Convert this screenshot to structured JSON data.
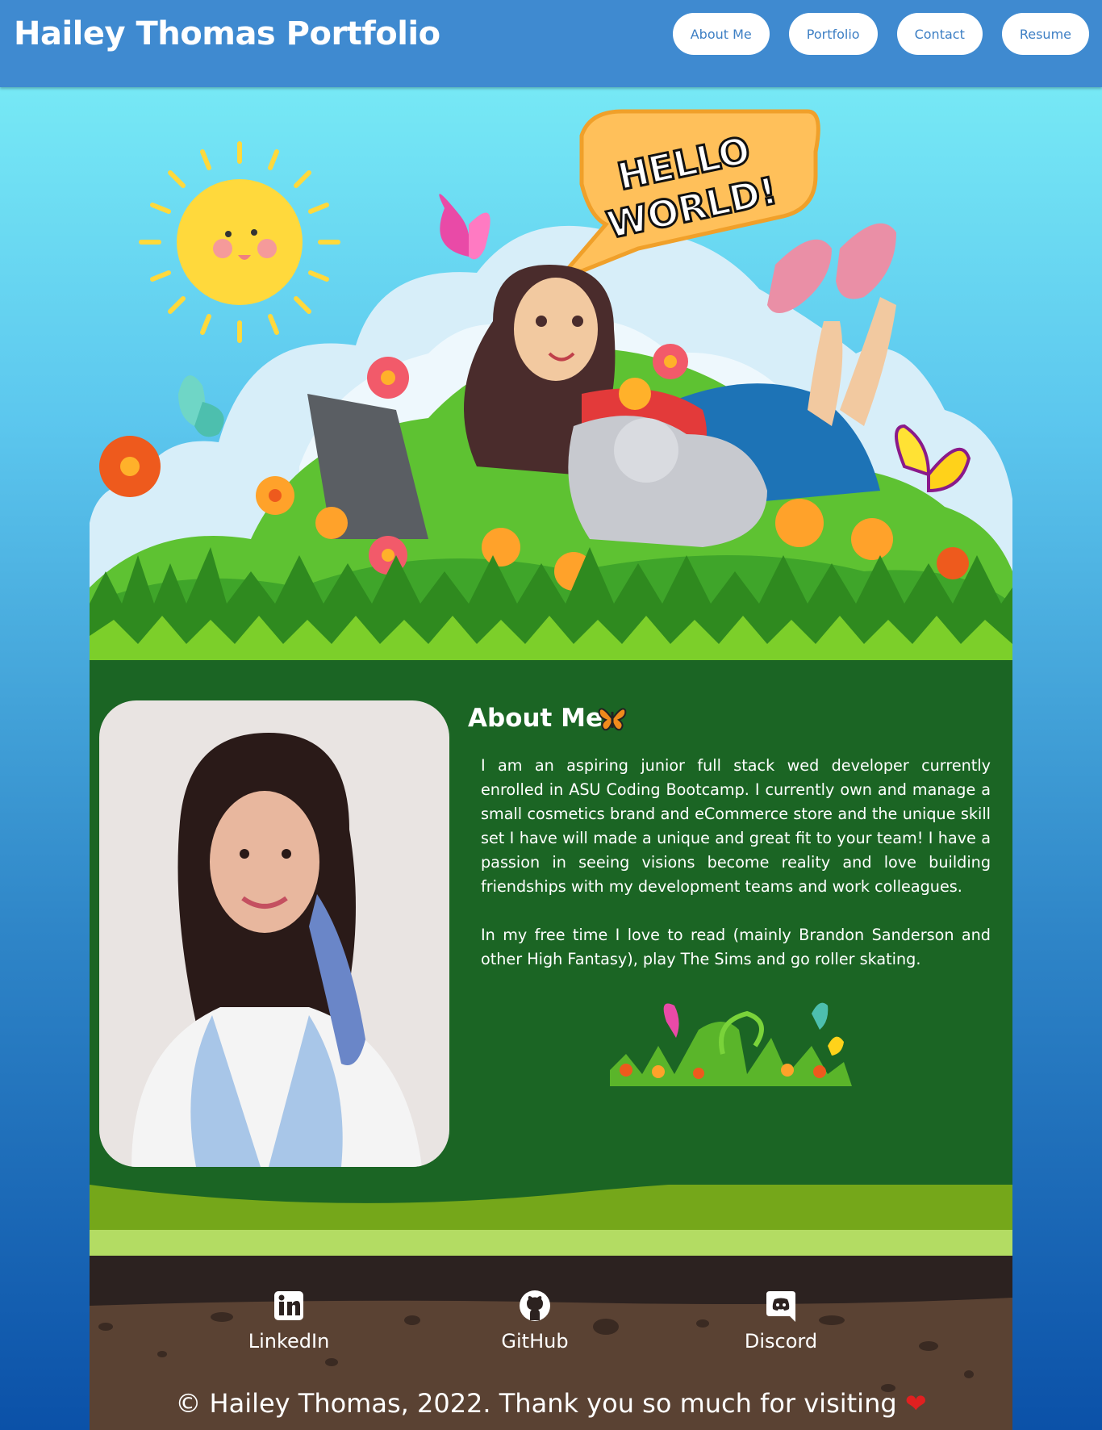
{
  "header": {
    "title": "Hailey Thomas Portfolio",
    "nav": [
      "About Me",
      "Portfolio",
      "Contact",
      "Resume"
    ]
  },
  "hero": {
    "speech_bubble": "HELLO WORLD!"
  },
  "about": {
    "title": "About Me",
    "title_icon": "butterfly-icon",
    "paragraphs": [
      "I am an aspiring junior full stack wed developer currently enrolled in ASU Coding Bootcamp. I currently own and manage a small cosmetics brand and eCommerce store and the unique skill set I have will made a unique and great fit to your team! I have a passion in seeing visions become reality and love building friendships with my development teams and work colleagues.",
      "In my free time I love to read (mainly Brandon Sanderson and other High Fantasy), play The Sims and go roller skating."
    ]
  },
  "socials": [
    {
      "label": "LinkedIn",
      "icon": "linkedin-icon"
    },
    {
      "label": "GitHub",
      "icon": "github-icon"
    },
    {
      "label": "Discord",
      "icon": "discord-icon"
    }
  ],
  "footer": {
    "text": "© Hailey Thomas, 2022. Thank you so much for visiting",
    "icon": "heart-icon"
  },
  "colors": {
    "header_bg": "#3f8ad0",
    "about_bg": "#1b6524",
    "soil": "#5a4233",
    "grass": "#6fac1b"
  }
}
